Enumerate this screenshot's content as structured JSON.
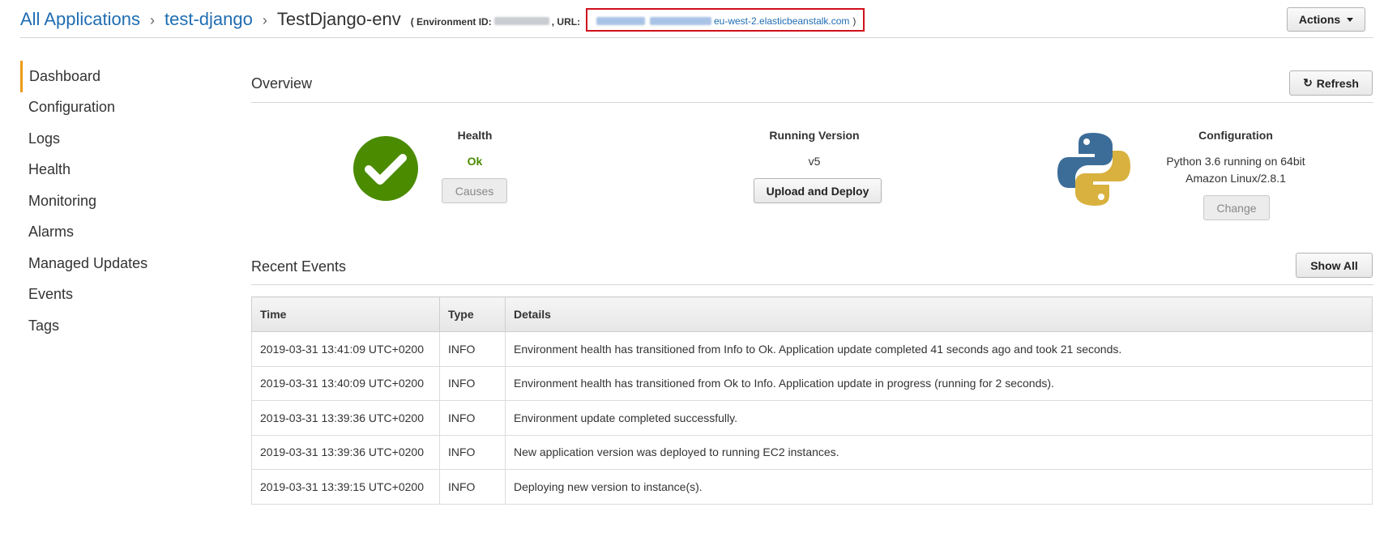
{
  "header": {
    "breadcrumb": [
      "All Applications",
      "test-django"
    ],
    "current": "TestDjango-env",
    "env_id_label": "( Environment ID:",
    "url_label": ", URL:",
    "url_visible": "eu-west-2.elasticbeanstalk.com",
    "url_close": ")",
    "actions_label": "Actions"
  },
  "sidebar": {
    "items": [
      {
        "label": "Dashboard",
        "active": true
      },
      {
        "label": "Configuration"
      },
      {
        "label": "Logs"
      },
      {
        "label": "Health"
      },
      {
        "label": "Monitoring"
      },
      {
        "label": "Alarms"
      },
      {
        "label": "Managed Updates"
      },
      {
        "label": "Events"
      },
      {
        "label": "Tags"
      }
    ]
  },
  "overview": {
    "title": "Overview",
    "refresh_label": "Refresh",
    "health": {
      "label": "Health",
      "value": "Ok",
      "button": "Causes"
    },
    "running_version": {
      "label": "Running Version",
      "value": "v5",
      "button": "Upload and Deploy"
    },
    "configuration": {
      "label": "Configuration",
      "line1": "Python 3.6 running on 64bit",
      "line2": "Amazon Linux/2.8.1",
      "button": "Change"
    },
    "colors": {
      "health_ok": "#4a8b00",
      "python_blue": "#3c6d98",
      "python_yellow": "#d8b13f"
    }
  },
  "events": {
    "title": "Recent Events",
    "show_all_label": "Show All",
    "columns": [
      "Time",
      "Type",
      "Details"
    ],
    "rows": [
      [
        "2019-03-31 13:41:09 UTC+0200",
        "INFO",
        "Environment health has transitioned from Info to Ok. Application update completed 41 seconds ago and took 21 seconds."
      ],
      [
        "2019-03-31 13:40:09 UTC+0200",
        "INFO",
        "Environment health has transitioned from Ok to Info. Application update in progress (running for 2 seconds)."
      ],
      [
        "2019-03-31 13:39:36 UTC+0200",
        "INFO",
        "Environment update completed successfully."
      ],
      [
        "2019-03-31 13:39:36 UTC+0200",
        "INFO",
        "New application version was deployed to running EC2 instances."
      ],
      [
        "2019-03-31 13:39:15 UTC+0200",
        "INFO",
        "Deploying new version to instance(s)."
      ]
    ]
  }
}
